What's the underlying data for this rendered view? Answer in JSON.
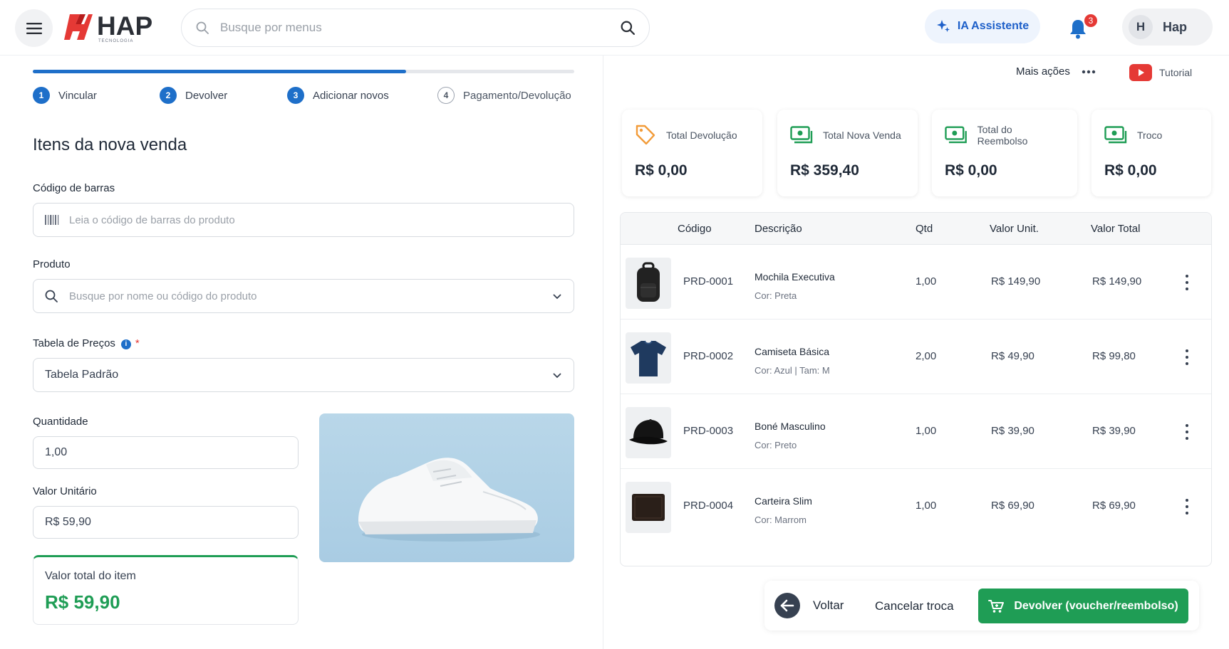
{
  "header": {
    "logo_text": "HAP",
    "logo_sub": "TECNOLOGIA",
    "search_placeholder": "Busque por menus",
    "ia_label": "IA Assistente",
    "notifications_count": "3",
    "user_initial": "H",
    "user_name": "Hap"
  },
  "steps": [
    {
      "num": "1",
      "label": "Vincular",
      "state": "done"
    },
    {
      "num": "2",
      "label": "Devolver",
      "state": "done"
    },
    {
      "num": "3",
      "label": "Adicionar novos",
      "state": "active"
    },
    {
      "num": "4",
      "label": "Pagamento/Devolução",
      "state": "pending"
    }
  ],
  "progress_fraction": 0.69,
  "form": {
    "title": "Itens da nova venda",
    "barcode_label": "Código de barras",
    "barcode_placeholder": "Leia o código de barras do produto",
    "product_label": "Produto",
    "product_placeholder": "Busque por nome ou código do produto",
    "price_table_label": "Tabela de Preços",
    "price_table_required": "*",
    "price_table_value": "Tabela Padrão",
    "quantity_label": "Quantidade",
    "quantity_value": "1,00",
    "unit_value_label": "Valor Unitário",
    "unit_value_value": "R$ 59,90",
    "item_total_label": "Valor total do item",
    "item_total_value": "R$ 59,90"
  },
  "actions": {
    "more_label": "Mais ações",
    "tutorial_label": "Tutorial"
  },
  "summary_cards": [
    {
      "label": "Total Devolução",
      "value": "R$ 0,00",
      "icon": "tag-icon"
    },
    {
      "label": "Total Nova Venda",
      "value": "R$ 359,40",
      "icon": "money-icon"
    },
    {
      "label": "Total do Reembolso",
      "value": "R$ 0,00",
      "icon": "money-icon"
    },
    {
      "label": "Troco",
      "value": "R$ 0,00",
      "icon": "money-icon"
    }
  ],
  "table": {
    "headers": {
      "code": "Código",
      "desc": "Descrição",
      "qty": "Qtd",
      "unit": "Valor Unit.",
      "total": "Valor Total"
    },
    "rows": [
      {
        "code": "PRD-0001",
        "desc": "Mochila Executiva",
        "sub": "Cor: Preta",
        "qty": "1,00",
        "unit": "R$ 149,90",
        "total": "R$ 149,90"
      },
      {
        "code": "PRD-0002",
        "desc": "Camiseta Básica",
        "sub": "Cor: Azul | Tam: M",
        "qty": "2,00",
        "unit": "R$ 49,90",
        "total": "R$ 99,80"
      },
      {
        "code": "PRD-0003",
        "desc": "Boné Masculino",
        "sub": "Cor: Preto",
        "qty": "1,00",
        "unit": "R$ 39,90",
        "total": "R$ 39,90"
      },
      {
        "code": "PRD-0004",
        "desc": "Carteira Slim",
        "sub": "Cor: Marrom",
        "qty": "1,00",
        "unit": "R$ 69,90",
        "total": "R$ 69,90"
      }
    ]
  },
  "footer": {
    "back_label": "Voltar",
    "cancel_label": "Cancelar troca",
    "submit_label": "Devolver (voucher/reembolso)"
  },
  "colors": {
    "primary": "#1e6fc9",
    "success": "#1f9d55",
    "danger": "#e53935"
  }
}
